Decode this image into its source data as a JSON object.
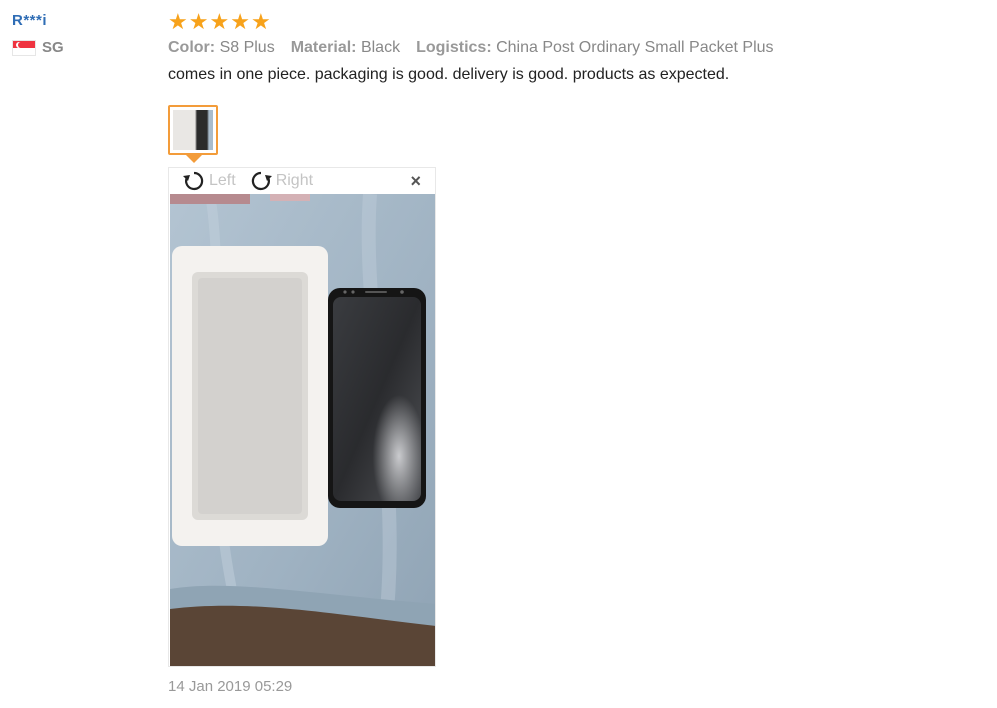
{
  "reviewer": {
    "name": "R***i",
    "country_code": "SG",
    "flag_icon": "singapore-flag-icon"
  },
  "review": {
    "rating": 5,
    "stars": [
      "★",
      "★",
      "★",
      "★",
      "★"
    ],
    "star_color": "#f7a21b",
    "attributes": [
      {
        "key": "Color:",
        "value": "S8 Plus"
      },
      {
        "key": "Material:",
        "value": "Black"
      },
      {
        "key": "Logistics:",
        "value": "China Post Ordinary Small Packet Plus"
      }
    ],
    "text": "comes in one piece. packaging is good. delivery is good. products as expected.",
    "date": "14 Jan 2019 05:29"
  },
  "viewer": {
    "rotate_left_label": "Left",
    "rotate_right_label": "Right",
    "close_label": "×",
    "accent_color": "#f39c3a"
  }
}
